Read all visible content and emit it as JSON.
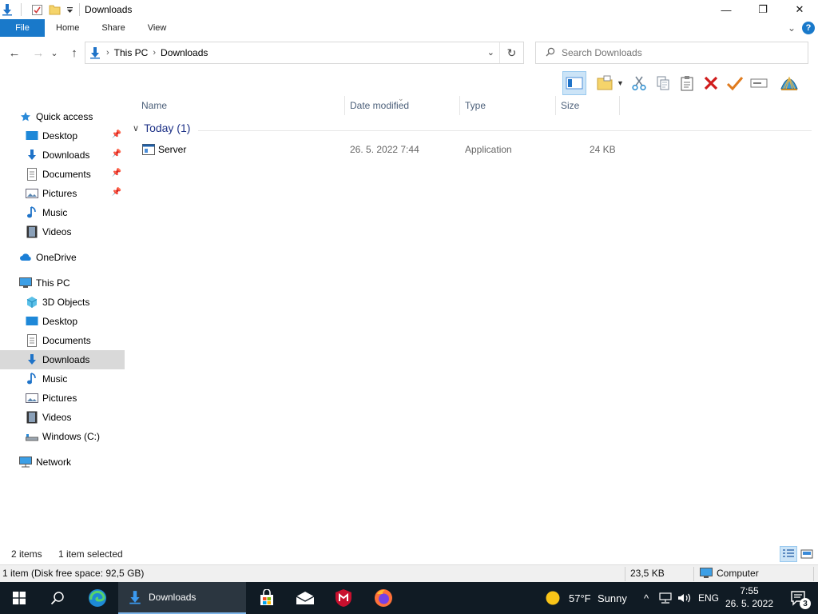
{
  "window": {
    "title": "Downloads",
    "controls": {
      "minimize": "—",
      "maximize": "❐",
      "close": "✕"
    }
  },
  "ribbon": {
    "tabs": [
      "File",
      "Home",
      "Share",
      "View"
    ],
    "expand_glyph": "⌄",
    "help": "?"
  },
  "address_bar": {
    "back": "←",
    "forward": "→",
    "recent": "⌄",
    "up": "↑",
    "crumbs": [
      "This PC",
      "Downloads"
    ],
    "separator": "›",
    "dropdown": "⌄",
    "refresh": "↻"
  },
  "search": {
    "placeholder": "Search Downloads"
  },
  "nav": {
    "quick_access": "Quick access",
    "quick_items": [
      "Desktop",
      "Downloads",
      "Documents",
      "Pictures",
      "Music",
      "Videos"
    ],
    "onedrive": "OneDrive",
    "this_pc": "This PC",
    "pc_items": [
      "3D Objects",
      "Desktop",
      "Documents",
      "Downloads",
      "Music",
      "Pictures",
      "Videos",
      "Windows (C:)"
    ],
    "network": "Network",
    "selected": "Downloads"
  },
  "columns": [
    "Name",
    "Date modified",
    "Type",
    "Size"
  ],
  "group": {
    "label": "Today (1)",
    "chevron": "∨"
  },
  "files": [
    {
      "name": "Server",
      "date": "26. 5. 2022 7:44",
      "type": "Application",
      "size": "24 KB"
    }
  ],
  "status": {
    "items": "2 items",
    "selected": "1 item selected"
  },
  "details": {
    "info": "1 item (Disk free space: 92,5 GB)",
    "size": "23,5 KB",
    "location": "Computer"
  },
  "taskbar": {
    "active_app": "Downloads",
    "weather": {
      "temp": "57°F",
      "condition": "Sunny"
    },
    "language": "ENG",
    "time": "7:55",
    "date": "26. 5. 2022",
    "notifications": "3"
  },
  "colors": {
    "accent": "#1979ca",
    "selection": "#cce4f7",
    "taskbar": "#101b24",
    "header_text": "#4c607a",
    "group_text": "#1e3287"
  }
}
